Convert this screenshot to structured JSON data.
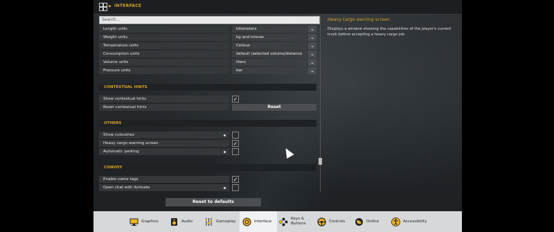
{
  "breadcrumb": {
    "section": "INTERFACE"
  },
  "search": {
    "placeholder": "Search..."
  },
  "units": [
    {
      "label": "Length units",
      "value": "kilometers"
    },
    {
      "label": "Weight units",
      "value": "kg and tonnes"
    },
    {
      "label": "Temperature units",
      "value": "Celsius"
    },
    {
      "label": "Consumption units",
      "value": "default (selected volume/distance units)"
    },
    {
      "label": "Volume units",
      "value": "liters"
    },
    {
      "label": "Pressure units",
      "value": "bar"
    }
  ],
  "contextual_hints": {
    "header": "CONTEXTUAL HINTS",
    "show_label": "Show contextual hints",
    "show_checked": true,
    "reset_label": "Reset contextual hints",
    "reset_button": "Reset"
  },
  "others": {
    "header": "OTHERS",
    "items": [
      {
        "label": "Show cutscenes",
        "checked": false,
        "dot": true
      },
      {
        "label": "Heavy cargo warning screen",
        "checked": true,
        "dot": false
      },
      {
        "label": "Automatic parking",
        "checked": false,
        "dot": true
      }
    ]
  },
  "convoy": {
    "header": "CONVOY",
    "items": [
      {
        "label": "Enable name tags",
        "checked": true,
        "dot": false
      },
      {
        "label": "Open chat with Activate",
        "checked": false,
        "dot": true
      }
    ]
  },
  "description": {
    "title": "Heavy cargo warning screen",
    "text": "Displays a window showing the capabilities of the player's current truck before accepting a heavy cargo job."
  },
  "reset_defaults": "Reset to defaults",
  "tabs": [
    {
      "label": "Graphics",
      "icon": "monitor-icon"
    },
    {
      "label": "Audio",
      "icon": "speaker-icon"
    },
    {
      "label": "Gameplay",
      "icon": "sliders-icon"
    },
    {
      "label": "Interface",
      "icon": "touch-icon",
      "active": true
    },
    {
      "label": "Keys &\nButtons",
      "icon": "gamepad-buttons-icon"
    },
    {
      "label": "Controls",
      "icon": "steering-wheel-icon"
    },
    {
      "label": "Online",
      "icon": "globe-icon"
    },
    {
      "label": "Accessibility",
      "icon": "accessibility-icon"
    }
  ],
  "colors": {
    "accent": "#d8a428",
    "panel": "#34383b",
    "bar": "#d6d8da"
  }
}
